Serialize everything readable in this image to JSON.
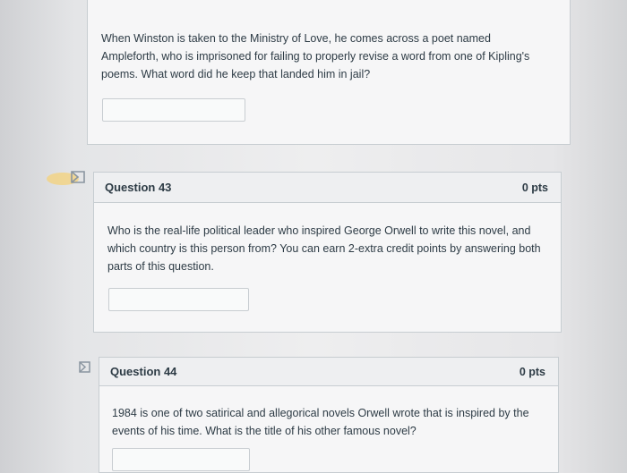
{
  "questions": [
    {
      "title": "",
      "points": "",
      "text": "When Winston is taken to the Ministry of Love, he comes across a poet named Ampleforth, who is imprisoned for failing to properly revise a word from one of Kipling's poems. What word did he keep that landed him in jail?",
      "answer_value": ""
    },
    {
      "title": "Question 43",
      "points": "0 pts",
      "text": "Who is the real-life political leader who inspired George Orwell to write this novel, and which country is this person from? You can earn 2-extra credit points by answering both parts of this question.",
      "answer_value": ""
    },
    {
      "title": "Question 44",
      "points": "0 pts",
      "text": "1984 is one of two satirical and allegorical novels Orwell wrote that is inspired by the events of his time. What is the title of his other famous novel?",
      "answer_value": ""
    }
  ],
  "icons": {
    "flag": "flag-icon"
  },
  "colors": {
    "text": "#2d3b45",
    "border": "#c7cdd1",
    "header_bg": "#eeeff1",
    "card_bg": "#f6f6f7",
    "highlight": "#f4c44a"
  }
}
